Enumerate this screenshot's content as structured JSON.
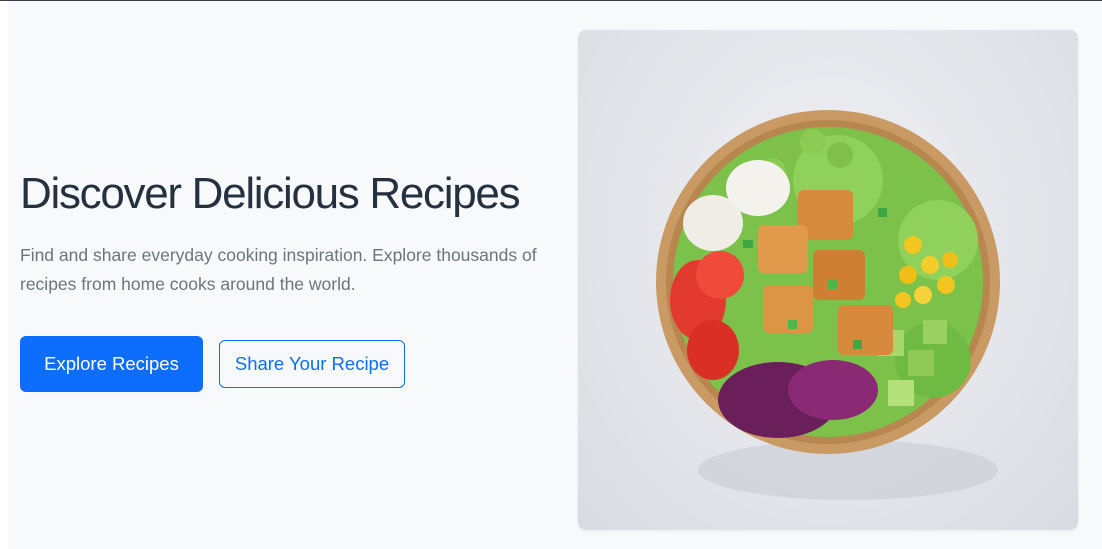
{
  "hero": {
    "title": "Discover Delicious Recipes",
    "description": "Find and share everyday cooking inspiration. Explore thousands of recipes from home cooks around the world.",
    "primary_button": "Explore Recipes",
    "secondary_button": "Share Your Recipe"
  },
  "colors": {
    "accent": "#0d6efd",
    "title": "#26313f",
    "body_text": "#6c757d",
    "background": "#f8f9fb"
  }
}
